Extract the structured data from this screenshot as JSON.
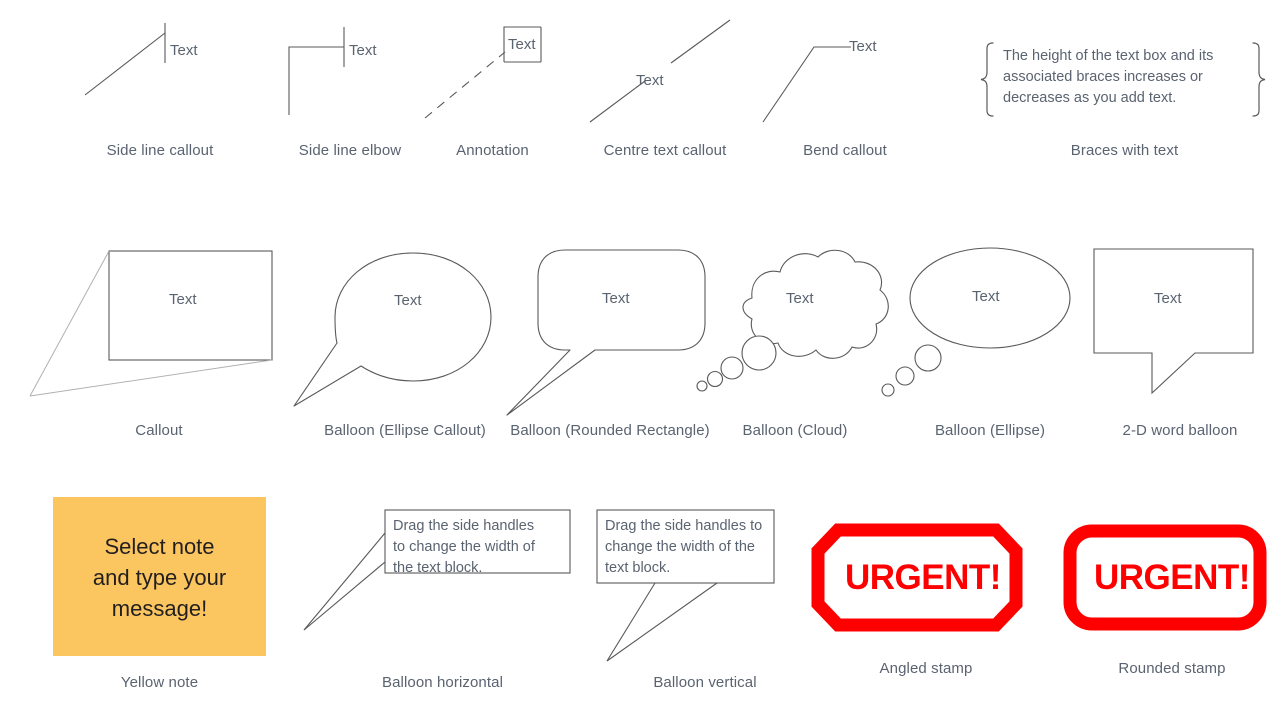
{
  "page": {
    "title": "Callouts and Annotations Stencil",
    "background_color": "#ffffff",
    "line_color": "#595959",
    "caption_color": "#5a6370",
    "text_color": "#5a6370",
    "note_fill_color": "#fbc55f",
    "note_text_color": "#231f20",
    "stamp_color": "#ff0000"
  },
  "common": {
    "text_label": "Text",
    "handles_message": "Drag the side handles to change the width of the text block.",
    "stamp_label": "URGENT!"
  },
  "rows": [
    {
      "row_index": 1,
      "shapes": [
        {
          "id": "side-line-callout",
          "caption": "Side line callout",
          "inner_text": "Text"
        },
        {
          "id": "side-line-elbow",
          "caption": "Side line elbow",
          "inner_text": "Text"
        },
        {
          "id": "annotation",
          "caption": "Annotation",
          "inner_text": "Text"
        },
        {
          "id": "centre-text-callout",
          "caption": "Centre text callout",
          "inner_text": "Text"
        },
        {
          "id": "bend-callout",
          "caption": "Bend callout",
          "inner_text": "Text"
        },
        {
          "id": "braces-with-text",
          "caption": "Braces with text",
          "inner_text": "The height of the text box and its associated braces increases or decreases as you add text."
        }
      ]
    },
    {
      "row_index": 2,
      "shapes": [
        {
          "id": "callout",
          "caption": "Callout",
          "inner_text": "Text"
        },
        {
          "id": "balloon-ellipse-callout",
          "caption": "Balloon (Ellipse Callout)",
          "inner_text": "Text"
        },
        {
          "id": "balloon-rounded-rectangle",
          "caption": "Balloon (Rounded Rectangle)",
          "inner_text": "Text"
        },
        {
          "id": "balloon-cloud",
          "caption": "Balloon (Cloud)",
          "inner_text": "Text"
        },
        {
          "id": "balloon-ellipse",
          "caption": "Balloon (Ellipse)",
          "inner_text": "Text"
        },
        {
          "id": "two-d-word-balloon",
          "caption": "2-D word balloon",
          "inner_text": "Text"
        }
      ]
    },
    {
      "row_index": 3,
      "shapes": [
        {
          "id": "yellow-note",
          "caption": "Yellow note",
          "inner_text": "Select note and type your message!",
          "inner_lines": [
            "Select note",
            "and type your",
            "message!"
          ]
        },
        {
          "id": "balloon-horizontal",
          "caption": "Balloon horizontal",
          "inner_text": "Drag the side handles to change the width of the text block.",
          "inner_lines": [
            "Drag the side handles",
            "to change the width of",
            "the text block."
          ]
        },
        {
          "id": "balloon-vertical",
          "caption": "Balloon vertical",
          "inner_text": "Drag the side handles to change the width of the text block.",
          "inner_lines": [
            "Drag the side handles to",
            "change the width of the",
            "text block."
          ]
        },
        {
          "id": "angled-stamp",
          "caption": "Angled stamp",
          "inner_text": "URGENT!"
        },
        {
          "id": "rounded-stamp",
          "caption": "Rounded stamp",
          "inner_text": "URGENT!"
        }
      ]
    }
  ]
}
